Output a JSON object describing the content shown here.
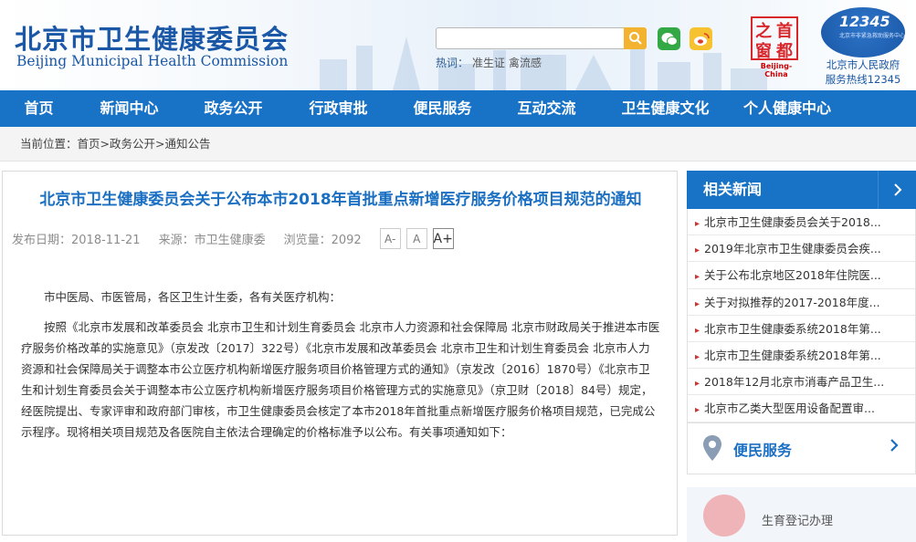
{
  "header": {
    "title_cn": "北京市卫生健康委员会",
    "title_en": "Beijing Municipal Health Commission",
    "hot_label": "热词：",
    "hot_terms": [
      "准生证",
      "禽流感"
    ],
    "city_logo_caption": "Beijing-China",
    "city_logo_chars": [
      "之",
      "首",
      "窗",
      "都"
    ],
    "hotline_number": "12345",
    "hotline_sub": "北京市非紧急救助服务中心",
    "hotline_line1": "北京市人民政府",
    "hotline_line2": "服务热线12345"
  },
  "nav": [
    "首页",
    "新闻中心",
    "政务公开",
    "行政审批",
    "便民服务",
    "互动交流",
    "卫生健康文化",
    "个人健康中心"
  ],
  "breadcrumb": "当前位置：首页>政务公开>通知公告",
  "article": {
    "title": "北京市卫生健康委员会关于公布本市2018年首批重点新增医疗服务价格项目规范的通知",
    "date": "发布日期：2018-11-21",
    "source": "来源：市卫生健康委",
    "views": "浏览量：2092",
    "font_small": "A-",
    "font_mid": "A",
    "font_big": "A+",
    "p1": "市中医局、市医管局，各区卫生计生委，各有关医疗机构：",
    "p2": "按照《北京市发展和改革委员会 北京市卫生和计划生育委员会 北京市人力资源和社会保障局 北京市财政局关于推进本市医疗服务价格改革的实施意见》（京发改〔2017〕322号）《北京市发展和改革委员会 北京市卫生和计划生育委员会 北京市人力资源和社会保障局关于调整本市公立医疗机构新增医疗服务项目价格管理方式的通知》（京发改〔2016〕1870号）《北京市卫生和计划生育委员会关于调整本市公立医疗机构新增医疗服务项目价格管理方式的实施意见》（京卫财〔2018〕84号）规定，经医院提出、专家评审和政府部门审核，市卫生健康委员会核定了本市2018年首批重点新增医疗服务价格项目规范，已完成公示程序。现将相关项目规范及各医院自主依法合理确定的价格标准予以公布。有关事项通知如下："
  },
  "sidebar": {
    "related_title": "相关新闻",
    "news": [
      "北京市卫生健康委员会关于2018...",
      "2019年北京市卫生健康委员会疾...",
      "关于公布北京地区2018年住院医...",
      "关于对拟推荐的2017-2018年度...",
      "北京市卫生健康委系统2018年第...",
      "北京市卫生健康委系统2018年第...",
      "2018年12月北京市消毒产品卫生...",
      "北京市乙类大型医用设备配置审..."
    ],
    "service_title": "便民服务",
    "service_item": "生育登记办理"
  },
  "colors": {
    "brand_blue": "#1872c6",
    "title_blue": "#1a6fc2",
    "hot_red": "#d8262b"
  }
}
